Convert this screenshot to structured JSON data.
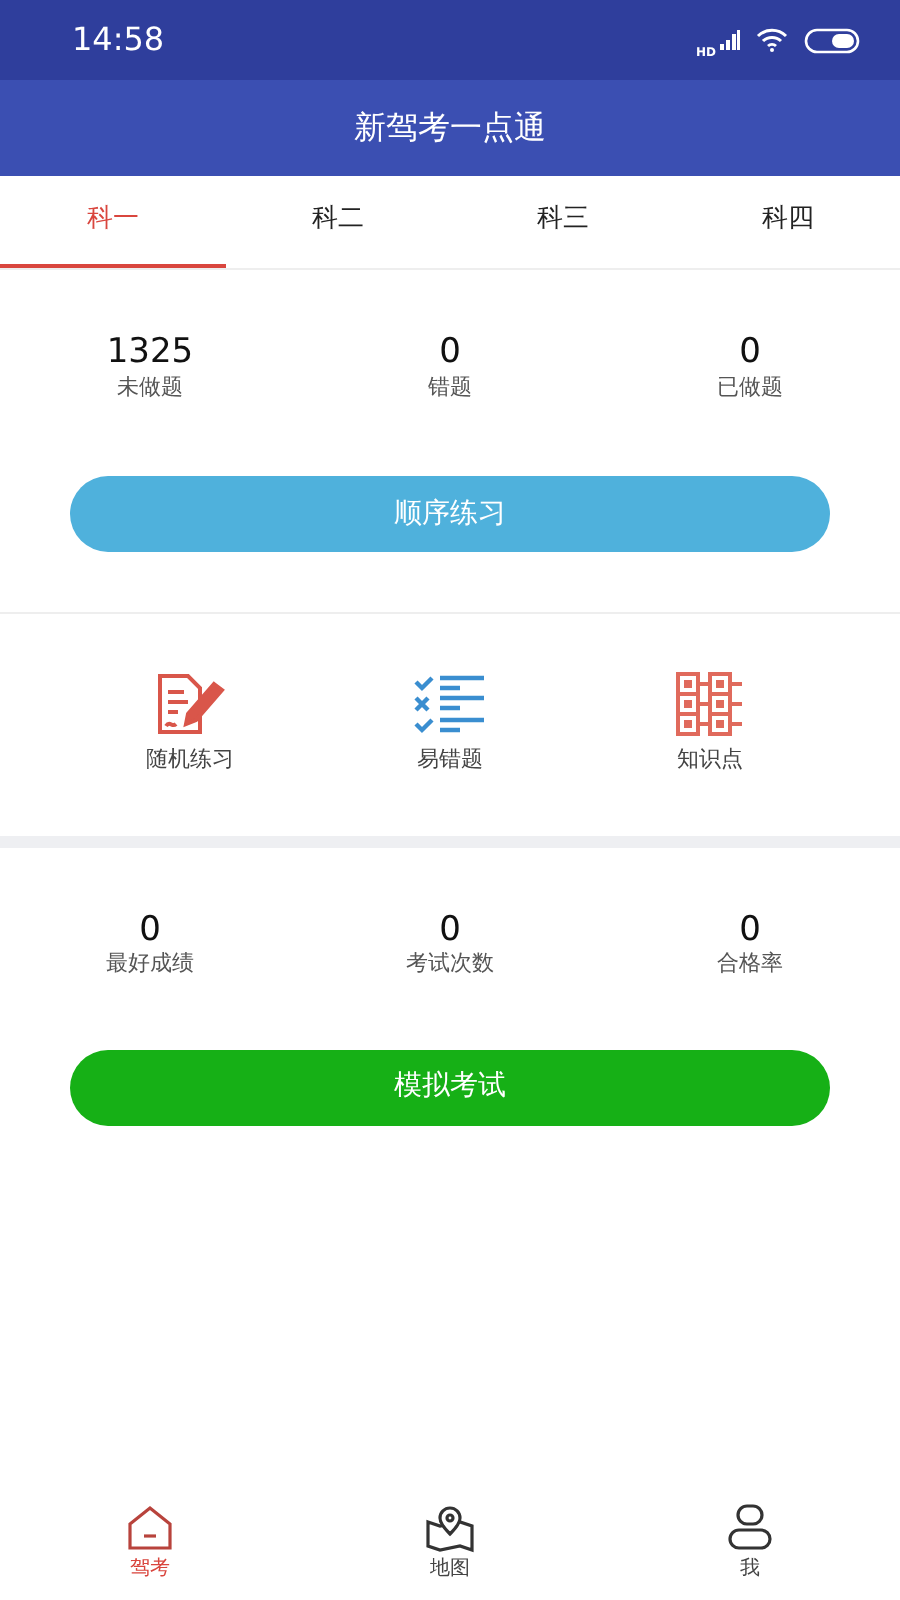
{
  "status_bar": {
    "time": "14:58",
    "network": "HD"
  },
  "title": "新驾考一点通",
  "tabs": [
    {
      "label": "科一",
      "selected": true
    },
    {
      "label": "科二",
      "selected": false
    },
    {
      "label": "科三",
      "selected": false
    },
    {
      "label": "科四",
      "selected": false
    }
  ],
  "practice_stats": [
    {
      "value": "1325",
      "label": "未做题"
    },
    {
      "value": "0",
      "label": "错题"
    },
    {
      "value": "0",
      "label": "已做题"
    }
  ],
  "practice_button": "顺序练习",
  "shortcuts": [
    {
      "kind": "pen",
      "label": "随机练习"
    },
    {
      "kind": "checklist",
      "label": "易错题"
    },
    {
      "kind": "grid",
      "label": "知识点"
    }
  ],
  "exam_stats": [
    {
      "value": "0",
      "label": "最好成绩"
    },
    {
      "value": "0",
      "label": "考试次数"
    },
    {
      "value": "0",
      "label": "合格率"
    }
  ],
  "exam_button": "模拟考试",
  "bottom_nav": [
    {
      "kind": "home",
      "label": "驾考",
      "selected": true
    },
    {
      "kind": "map",
      "label": "地图",
      "selected": false
    },
    {
      "kind": "user",
      "label": "我",
      "selected": false
    }
  ]
}
